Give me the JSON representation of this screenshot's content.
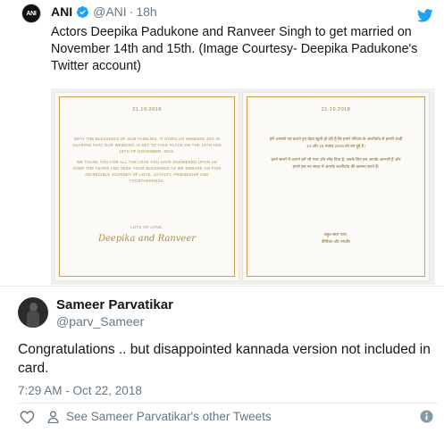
{
  "quoted_tweet": {
    "avatar_text": "ANI",
    "name": "ANI",
    "handle": "@ANI",
    "separator": "·",
    "time": "18h",
    "text": "Actors Deepika Padukone and Ranveer Singh to get married on November 14th and 15th. (Image Courtesy- Deepika Padukone's Twitter account)",
    "card_left": {
      "date": "21.10.2018",
      "paragraph_1": "WITH THE BLESSINGS OF OUR FAMILIES, IT GIVES US IMMENSE JOY IN SHARING THAT OUR WEDDING IS SET TO TAKE PLACE ON THE 14TH AND 15TH OF NOVEMBER, 2018.",
      "paragraph_2": "WE THANK YOU FOR ALL THE LOVE YOU HAVE SHOWERED UPON US OVER THE YEARS AND SEEK YOUR BLESSINGS AS WE EMBARK ON THIS INCREDIBLE JOURNEY OF LOVE, LOYALTY, FRIENDSHIP AND TOGETHERNESS.",
      "closing": "LOTS OF LOVE,",
      "signature": "Deepika and Ranveer"
    },
    "card_right": {
      "date": "21.10.2018",
      "paragraph_1": "हमें आपको यह बताते हुए बेहद ख़ुशी हो रही है कि हमारे परिवार के आशीर्वाद से हमारी शादी 14 और 15 नवंबर 2018 को तय हुई है।",
      "paragraph_2": "इतने सालों में आपने हमें जो प्यार और स्नेह दिया है, उसके लिए हम आपके आभारी हैं और हमारे इस नए सफ़र में आपके आशीर्वाद की कामना करते हैं।",
      "closing": "बहुत सारा प्यार,",
      "signature": "दीपिका और रणवीर"
    }
  },
  "reply_tweet": {
    "name": "Sameer Parvatikar",
    "handle": "@parv_Sameer",
    "text": "Congratulations .. but disappointed kannada version not included in card.",
    "timestamp": "7:29 AM - Oct 22, 2018",
    "see_other_tweets": "See Sameer Parvatikar's other Tweets"
  },
  "icons": {
    "verified": "verified-badge-icon",
    "twitter": "twitter-bird-icon",
    "like": "heart-icon",
    "profile": "person-icon",
    "info": "info-icon"
  },
  "colors": {
    "twitter_blue": "#1da1f2",
    "secondary_text": "#657786",
    "gold": "#c7a24b"
  }
}
